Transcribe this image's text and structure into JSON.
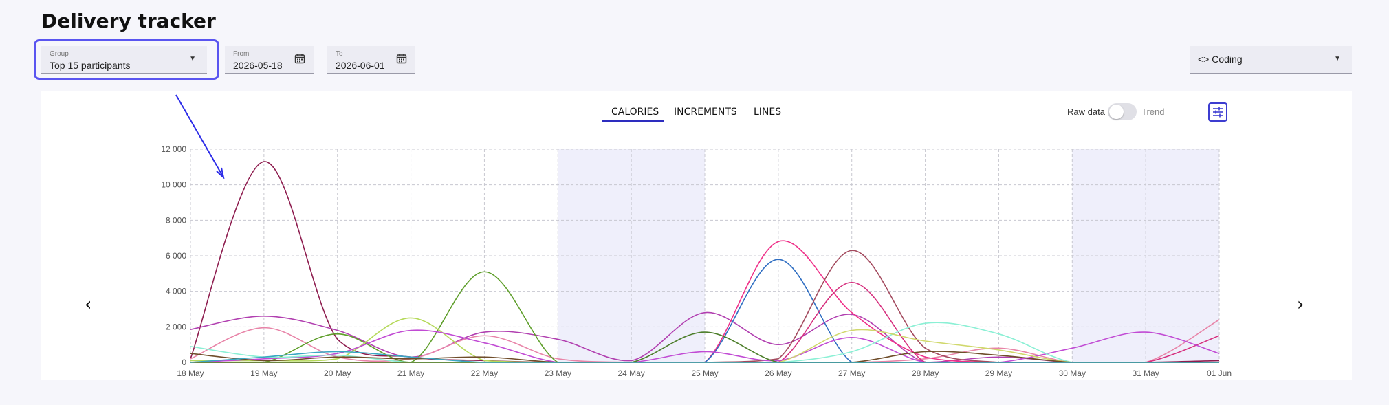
{
  "page": {
    "title": "Delivery tracker"
  },
  "filters": {
    "group": {
      "label": "Group",
      "value": "Top 15 participants"
    },
    "from": {
      "label": "From",
      "value": "2026-05-18"
    },
    "to": {
      "label": "To",
      "value": "2026-06-01"
    },
    "category": {
      "icon": "code-icon",
      "value": "Coding"
    }
  },
  "tabs": [
    {
      "label": "CALORIES",
      "active": true
    },
    {
      "label": "INCREMENTS",
      "active": false
    },
    {
      "label": "LINES",
      "active": false
    }
  ],
  "view_toggle": {
    "left_label": "Raw data",
    "right_label": "Trend",
    "trend_on": false
  },
  "nav": {
    "prev": "‹",
    "next": "›"
  },
  "colors": {
    "accent": "#2d2dbf",
    "highlight": "#5a55f0",
    "weekend": "#efeffb"
  },
  "chart_data": {
    "type": "line",
    "x": [
      "18 May",
      "19 May",
      "20 May",
      "21 May",
      "22 May",
      "23 May",
      "24 May",
      "25 May",
      "26 May",
      "27 May",
      "28 May",
      "29 May",
      "30 May",
      "31 May",
      "01 Jun"
    ],
    "ylim": [
      0,
      12000
    ],
    "yticks": [
      "0",
      "2 000",
      "4 000",
      "6 000",
      "8 000",
      "10 000",
      "12 000"
    ],
    "grid": true,
    "weekend_bands": [
      [
        "23 May",
        "25 May"
      ],
      [
        "30 May",
        "01 Jun"
      ]
    ],
    "series": [
      {
        "color": "#8e1d4f",
        "values": [
          200,
          11300,
          1300,
          300,
          100,
          0,
          0,
          0,
          0,
          0,
          0,
          0,
          0,
          0,
          100
        ]
      },
      {
        "color": "#b13fb0",
        "values": [
          1850,
          2600,
          1800,
          300,
          1700,
          1300,
          100,
          2800,
          1000,
          2700,
          0,
          300,
          0,
          0,
          0
        ]
      },
      {
        "color": "#e884a8",
        "values": [
          200,
          1950,
          300,
          200,
          1500,
          200,
          0,
          0,
          0,
          0,
          200,
          800,
          0,
          0,
          2400
        ]
      },
      {
        "color": "#5e9e2a",
        "values": [
          0,
          0,
          1600,
          0,
          5100,
          0,
          0,
          0,
          0,
          0,
          0,
          0,
          0,
          0,
          0
        ]
      },
      {
        "color": "#b5d95a",
        "values": [
          100,
          100,
          200,
          2500,
          100,
          0,
          0,
          0,
          0,
          0,
          0,
          0,
          0,
          0,
          0
        ]
      },
      {
        "color": "#ef2f88",
        "values": [
          0,
          0,
          0,
          0,
          0,
          0,
          0,
          0,
          6800,
          2800,
          300,
          0,
          0,
          0,
          0
        ]
      },
      {
        "color": "#2f6ec2",
        "values": [
          0,
          0,
          0,
          0,
          0,
          0,
          0,
          0,
          5800,
          0,
          0,
          0,
          0,
          0,
          0
        ]
      },
      {
        "color": "#a34a5e",
        "values": [
          0,
          0,
          0,
          0,
          0,
          0,
          0,
          0,
          200,
          6300,
          800,
          0,
          0,
          0,
          0
        ]
      },
      {
        "color": "#d62f7e",
        "values": [
          0,
          0,
          0,
          0,
          0,
          0,
          0,
          0,
          0,
          4500,
          0,
          0,
          0,
          0,
          1500
        ]
      },
      {
        "color": "#c14bd4",
        "values": [
          0,
          200,
          500,
          1800,
          1100,
          0,
          0,
          600,
          100,
          1400,
          0,
          0,
          800,
          1700,
          500
        ]
      },
      {
        "color": "#8bf0d5",
        "values": [
          900,
          300,
          400,
          0,
          0,
          0,
          0,
          0,
          0,
          600,
          2200,
          1600,
          0,
          0,
          0
        ]
      },
      {
        "color": "#d0d86c",
        "values": [
          0,
          0,
          0,
          0,
          0,
          0,
          0,
          0,
          0,
          1800,
          1200,
          700,
          0,
          0,
          0
        ]
      },
      {
        "color": "#4c7e2a",
        "values": [
          0,
          0,
          0,
          0,
          0,
          0,
          0,
          1700,
          0,
          0,
          0,
          0,
          0,
          0,
          0
        ]
      },
      {
        "color": "#6f4d2a",
        "values": [
          500,
          100,
          300,
          200,
          300,
          0,
          0,
          0,
          0,
          0,
          600,
          400,
          0,
          0,
          0
        ]
      },
      {
        "color": "#3aa7c2",
        "values": [
          0,
          300,
          600,
          300,
          0,
          0,
          0,
          0,
          0,
          0,
          0,
          0,
          0,
          0,
          0
        ]
      }
    ]
  }
}
